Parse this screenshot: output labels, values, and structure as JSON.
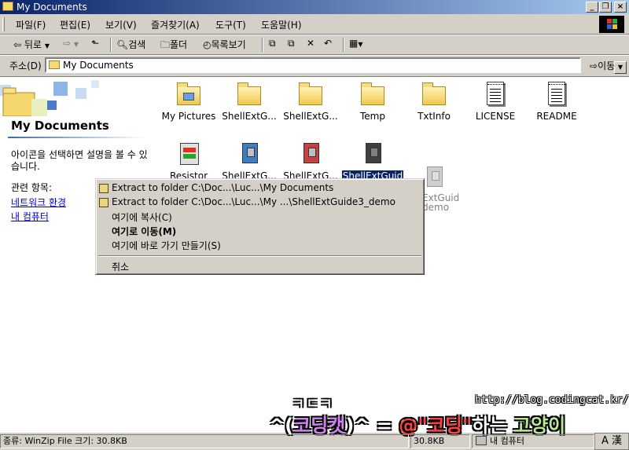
{
  "window": {
    "title": "My Documents"
  },
  "menubar": {
    "items": [
      "파일(F)",
      "편집(E)",
      "보기(V)",
      "즐겨찾기(A)",
      "도구(T)",
      "도움말(H)"
    ]
  },
  "toolbar": {
    "back": "뒤로",
    "search": "검색",
    "folders": "폴더",
    "list": "목록보기"
  },
  "address": {
    "label": "주소(D)",
    "value": "My Documents",
    "go": "이동"
  },
  "left_pane": {
    "title": "My Documents",
    "hint": "아이콘을 선택하면 설명을 볼 수 있습니다.",
    "related": "관련 항목:",
    "links": [
      "네트워크 환경",
      "내 컴퓨터"
    ]
  },
  "files": [
    {
      "name": "My Pictures",
      "icon": "pictures-folder-icon"
    },
    {
      "name": "ShellExtG...",
      "icon": "folder-icon"
    },
    {
      "name": "ShellExtG...",
      "icon": "folder-icon"
    },
    {
      "name": "Temp",
      "icon": "folder-icon"
    },
    {
      "name": "TxtInfo",
      "icon": "folder-icon"
    },
    {
      "name": "LICENSE",
      "icon": "text-file-icon"
    },
    {
      "name": "README",
      "icon": "text-file-icon"
    },
    {
      "name": "Resistor",
      "icon": "program-icon"
    },
    {
      "name": "ShellExtG...",
      "icon": "zip-icon"
    },
    {
      "name": "ShellExtG...",
      "icon": "zip-icon"
    },
    {
      "name": "ShellExtGuid",
      "icon": "zip-icon"
    },
    {
      "name": "ExtGuid",
      "icon": "zip-icon"
    },
    {
      "name": "demo",
      "icon": ""
    }
  ],
  "context_menu": {
    "items": [
      "Extract to folder C:\\Doc...\\Luc...\\My Documents",
      "Extract to folder C:\\Doc...\\Luc...\\My ...\\ShellExtGuide3_demo",
      "여기에 복사(C)",
      "여기로 이동(M)",
      "여기에 바로 가기 만들기(S)",
      "취소"
    ]
  },
  "statusbar": {
    "text": "종류: WinZip File 크기: 30.8KB",
    "size": "30.8KB",
    "location": "내 컴퓨터"
  },
  "ime": "A 漢",
  "watermark": {
    "url": "http://blog.codingcat.kr/",
    "initials": "ㅋㄷㅋ",
    "p1": "^(",
    "p2": "코딩캣",
    "p3": ")^ = ",
    "p4": "@",
    "p5": "\"코딩\"",
    "p6": "하는 ",
    "p7": "고양이"
  },
  "colors": {
    "title_gradient_start": "#0a246a",
    "title_gradient_end": "#a6caf0",
    "selection": "#0a246a",
    "link": "#0000cc"
  }
}
